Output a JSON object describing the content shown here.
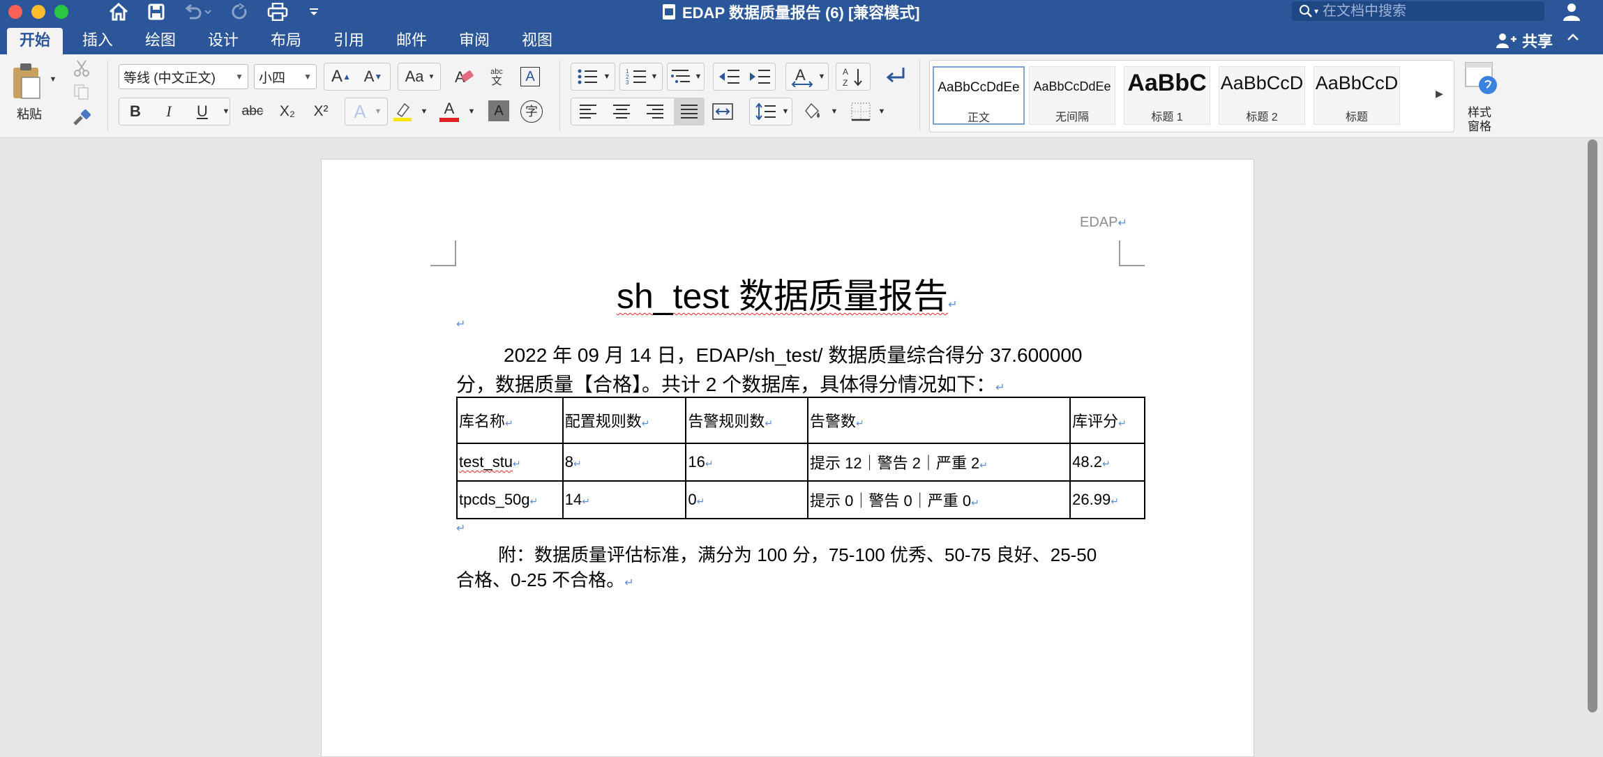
{
  "window": {
    "title": "EDAP 数据质量报告 (6) [兼容模式]",
    "search_placeholder": "在文档中搜索"
  },
  "tabs": [
    "开始",
    "插入",
    "绘图",
    "设计",
    "布局",
    "引用",
    "邮件",
    "审阅",
    "视图"
  ],
  "share_label": "共享",
  "ribbon": {
    "paste_label": "粘贴",
    "font_name": "等线 (中文正文)",
    "font_size": "小四",
    "styles": [
      {
        "preview": "AaBbCcDdEe",
        "name": "正文"
      },
      {
        "preview": "AaBbCcDdEe",
        "name": "无间隔"
      },
      {
        "preview": "AaBbC",
        "name": "标题 1"
      },
      {
        "preview": "AaBbCcD",
        "name": "标题 2"
      },
      {
        "preview": "AaBbCcD",
        "name": "标题"
      }
    ],
    "styles_pane_label": "样式\n窗格",
    "format_buttons": {
      "bold": "B",
      "italic": "I",
      "underline": "U",
      "strike": "abc",
      "subscript": "X₂",
      "superscript": "X²",
      "font_color": "A",
      "char_shading": "A",
      "enclose": "字",
      "spell": "abc"
    }
  },
  "document": {
    "header": "EDAP",
    "title": "sh_test 数据质量报告",
    "paragraph_line1": "2022 年 09 月 14 日，EDAP/sh_test/ 数据质量综合得分 37.600000",
    "paragraph_line2": "分，数据质量【合格】。共计 2 个数据库，具体得分情况如下：",
    "table": {
      "headers": [
        "库名称",
        "配置规则数",
        "告警规则数",
        "告警数",
        "库评分"
      ],
      "rows": [
        [
          "test_stu",
          "8",
          "16",
          "提示 12｜警告 2｜严重 2",
          "48.2"
        ],
        [
          "tpcds_50g",
          "14",
          "0",
          "提示 0｜警告 0｜严重 0",
          "26.99"
        ]
      ]
    },
    "footnote_line1": "附：数据质量评估标准，满分为 100 分，75-100 优秀、50-75 良好、25-50",
    "footnote_line2": "合格、0-25 不合格。"
  },
  "colors": {
    "accent": "#2b579a",
    "paragraph_mark": "#5b8ed6",
    "spell_error": "#e22222"
  }
}
